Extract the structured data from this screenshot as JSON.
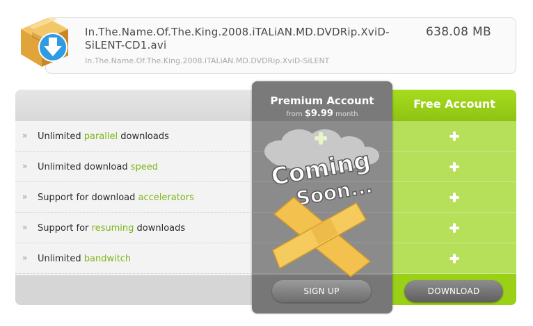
{
  "file": {
    "name": "In.The.Name.Of.The.King.2008.iTALiAN.MD.DVDRip.XviD-SiLENT-CD1.avi",
    "size": "638.08 MB",
    "release": "In.The.Name.Of.The.King.2008.iTALiAN.MD.DVDRip.XviD-SiLENT",
    "icon": "package-download-icon"
  },
  "features": [
    {
      "before": "Unlimited ",
      "highlight": "parallel",
      "after": " downloads"
    },
    {
      "before": "Unlimited download ",
      "highlight": "speed",
      "after": ""
    },
    {
      "before": "Support for download ",
      "highlight": "accelerators",
      "after": ""
    },
    {
      "before": "Support for ",
      "highlight": "resuming",
      "after": " downloads"
    },
    {
      "before": "Unlimited ",
      "highlight": "bandwitch",
      "after": ""
    }
  ],
  "premium": {
    "title": "Premium Account",
    "price_prefix": "from",
    "price_amount": "$9.99",
    "price_suffix": "month",
    "overlay_line1": "Coming",
    "overlay_line2": "Soon...",
    "button_label": "SIGN UP"
  },
  "free": {
    "title": "Free Account",
    "button_label": "DOWNLOAD",
    "icon": "plus-icon"
  },
  "colors": {
    "accent_green": "#9ad016",
    "highlight_green": "#7cb518",
    "premium_gray": "#777777",
    "tape_yellow": "#f2c14e"
  }
}
